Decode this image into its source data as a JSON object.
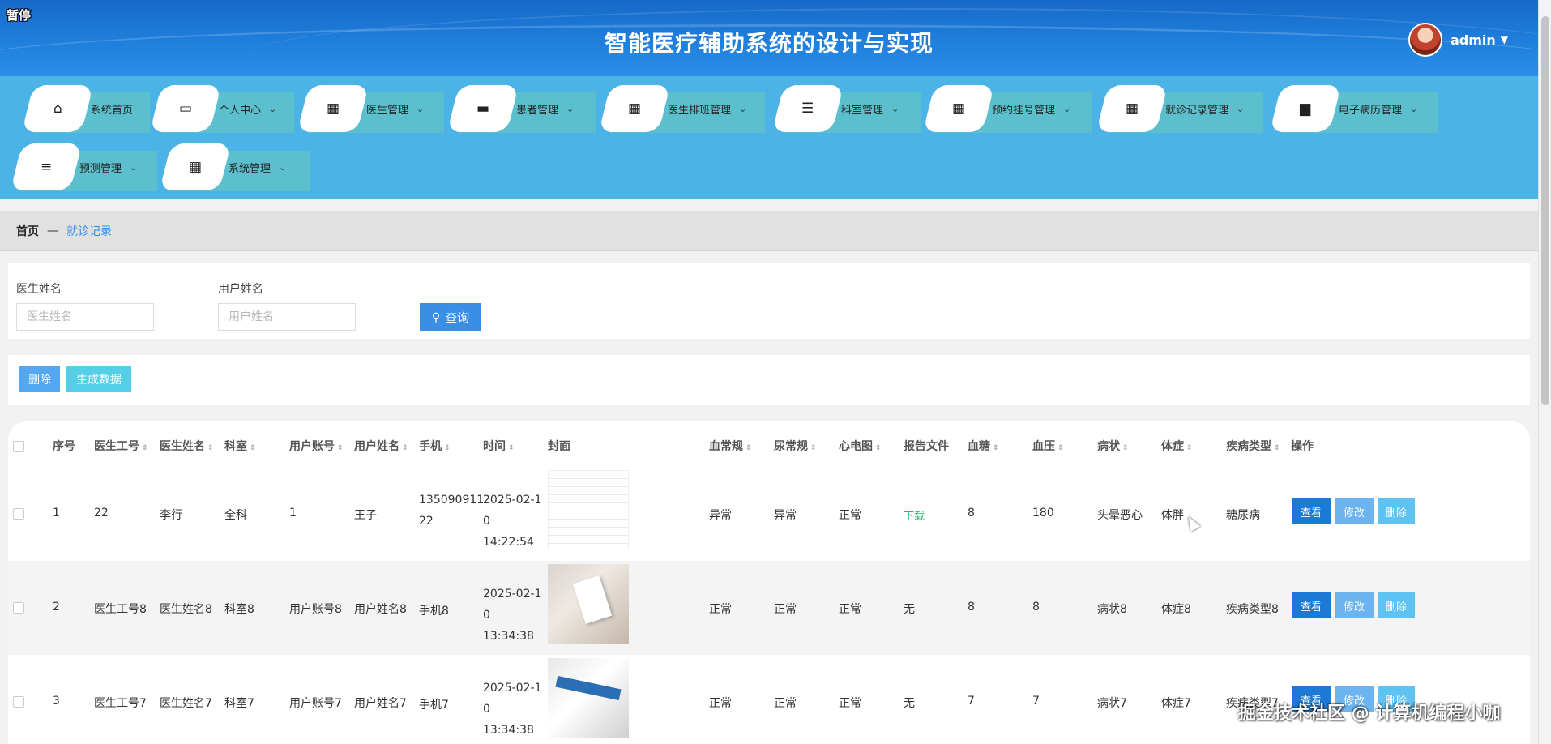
{
  "header": {
    "pause_tag": "暂停",
    "title": "智能医疗辅助系统的设计与实现",
    "user_name": "admin",
    "user_caret": "▼"
  },
  "nav": {
    "items": [
      {
        "label": "系统首页",
        "icon": "home-icon",
        "glyph": "⌂",
        "dropdown": false
      },
      {
        "label": "个人中心",
        "icon": "card-icon",
        "glyph": "▭",
        "dropdown": true
      },
      {
        "label": "医生管理",
        "icon": "grid-icon",
        "glyph": "▦",
        "dropdown": true
      },
      {
        "label": "患者管理",
        "icon": "chat-icon",
        "glyph": "▬",
        "dropdown": true
      },
      {
        "label": "医生排班管理",
        "icon": "grid-icon",
        "glyph": "▦",
        "dropdown": true
      },
      {
        "label": "科室管理",
        "icon": "list-icon",
        "glyph": "☰",
        "dropdown": true
      },
      {
        "label": "预约挂号管理",
        "icon": "apps-icon",
        "glyph": "▦",
        "dropdown": true
      },
      {
        "label": "就诊记录管理",
        "icon": "grid-icon",
        "glyph": "▦",
        "dropdown": true
      },
      {
        "label": "电子病历管理",
        "icon": "briefcase-icon",
        "glyph": "▆",
        "dropdown": true
      },
      {
        "label": "预测管理",
        "icon": "sliders-icon",
        "glyph": "≡",
        "dropdown": true
      },
      {
        "label": "系统管理",
        "icon": "grid-icon",
        "glyph": "▦",
        "dropdown": true
      }
    ],
    "chevron": "⌄"
  },
  "breadcrumb": {
    "home": "首页",
    "separator": "—",
    "current": "就诊记录"
  },
  "search": {
    "doctor_label": "医生姓名",
    "doctor_placeholder": "医生姓名",
    "user_label": "用户姓名",
    "user_placeholder": "用户姓名",
    "query_label": "查询"
  },
  "actions": {
    "delete_label": "删除",
    "generate_label": "生成数据"
  },
  "table": {
    "headers": {
      "index": "序号",
      "doctor_id": "医生工号",
      "doctor_name": "医生姓名",
      "dept": "科室",
      "user_account": "用户账号",
      "user_name": "用户姓名",
      "phone": "手机",
      "time": "时间",
      "cover": "封面",
      "blood": "血常规",
      "urine": "尿常规",
      "ecg": "心电图",
      "report": "报告文件",
      "glucose": "血糖",
      "pressure": "血压",
      "symptom": "病状",
      "sign": "体症",
      "disease": "疾病类型",
      "ops": "操作"
    },
    "sort_glyph": "⇕",
    "rows": [
      {
        "index": "1",
        "doctor_id": "22",
        "doctor_name": "李行",
        "dept": "全科",
        "user_account": "1",
        "user_name": "王子",
        "phone": "135090911 22",
        "time": "2025-02-1 0 14:22:54",
        "cover": "document",
        "blood": "异常",
        "urine": "异常",
        "ecg": "正常",
        "report": "下载",
        "glucose": "8",
        "pressure": "180",
        "symptom": "头晕恶心",
        "sign": "体胖",
        "disease": "糖尿病"
      },
      {
        "index": "2",
        "doctor_id": "医生工号8",
        "doctor_name": "医生姓名8",
        "dept": "科室8",
        "user_account": "用户账号8",
        "user_name": "用户姓名8",
        "phone": "手机8",
        "time": "2025-02-1 0 13:34:38",
        "cover": "hand-notebook",
        "blood": "正常",
        "urine": "正常",
        "ecg": "正常",
        "report": "无",
        "glucose": "8",
        "pressure": "8",
        "symptom": "病状8",
        "sign": "体症8",
        "disease": "疾病类型8"
      },
      {
        "index": "3",
        "doctor_id": "医生工号7",
        "doctor_name": "医生姓名7",
        "dept": "科室7",
        "user_account": "用户账号7",
        "user_name": "用户姓名7",
        "phone": "手机7",
        "time": "2025-02-1 0 13:34:38",
        "cover": "brochure",
        "blood": "正常",
        "urine": "正常",
        "ecg": "正常",
        "report": "无",
        "glucose": "7",
        "pressure": "7",
        "symptom": "病状7",
        "sign": "体症7",
        "disease": "疾病类型7"
      }
    ],
    "row_buttons": {
      "view": "查看",
      "edit": "修改",
      "delete": "删除"
    }
  },
  "watermark": "掘金技术社区 @ 计算机编程小咖"
}
